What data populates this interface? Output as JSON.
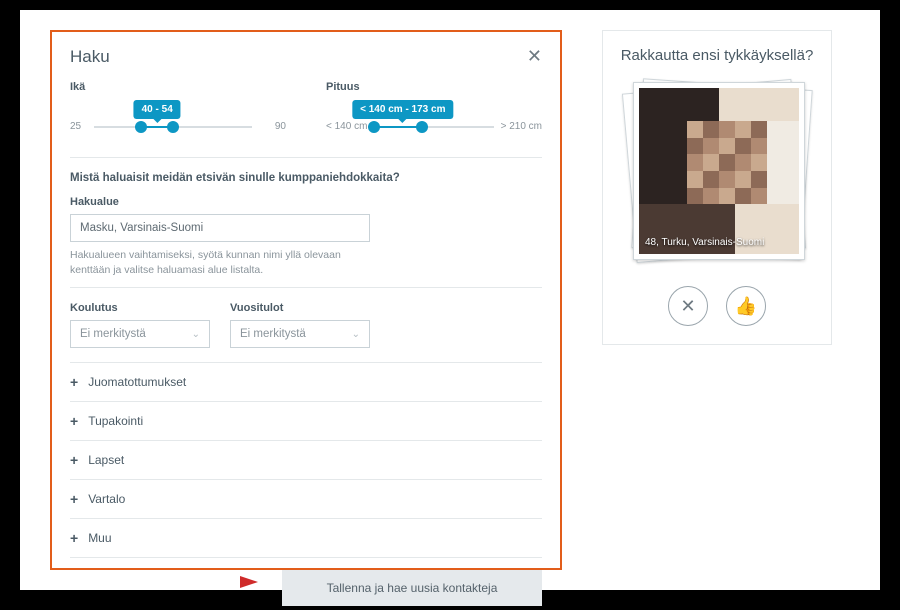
{
  "panel": {
    "title": "Haku",
    "age": {
      "label": "Ikä",
      "min": "25",
      "max": "90",
      "badge": "40 - 54"
    },
    "height": {
      "label": "Pituus",
      "min": "< 140 cm",
      "max": "> 210 cm",
      "badge": "< 140 cm - 173 cm"
    },
    "question": "Mistä haluaisit meidän etsivän sinulle kumppaniehdokkaita?",
    "area": {
      "label": "Hakualue",
      "value": "Masku, Varsinais-Suomi",
      "help": "Hakualueen vaihtamiseksi, syötä kunnan nimi yllä olevaan kenttään ja valitse haluamasi alue listalta."
    },
    "education": {
      "label": "Koulutus",
      "selected": "Ei merkitystä"
    },
    "income": {
      "label": "Vuositulot",
      "selected": "Ei merkitystä"
    },
    "accordion": {
      "drinking": "Juomatottumukset",
      "smoking": "Tupakointi",
      "children": "Lapset",
      "body": "Vartalo",
      "other": "Muu"
    },
    "submit": "Tallenna ja hae uusia kontakteja"
  },
  "sidebar": {
    "title": "Rakkautta ensi tykkäyksellä?",
    "caption": "48, Turku, Varsinais-Suomi"
  },
  "colors": {
    "accent": "#0d97c4",
    "border": "#e25d1a"
  }
}
